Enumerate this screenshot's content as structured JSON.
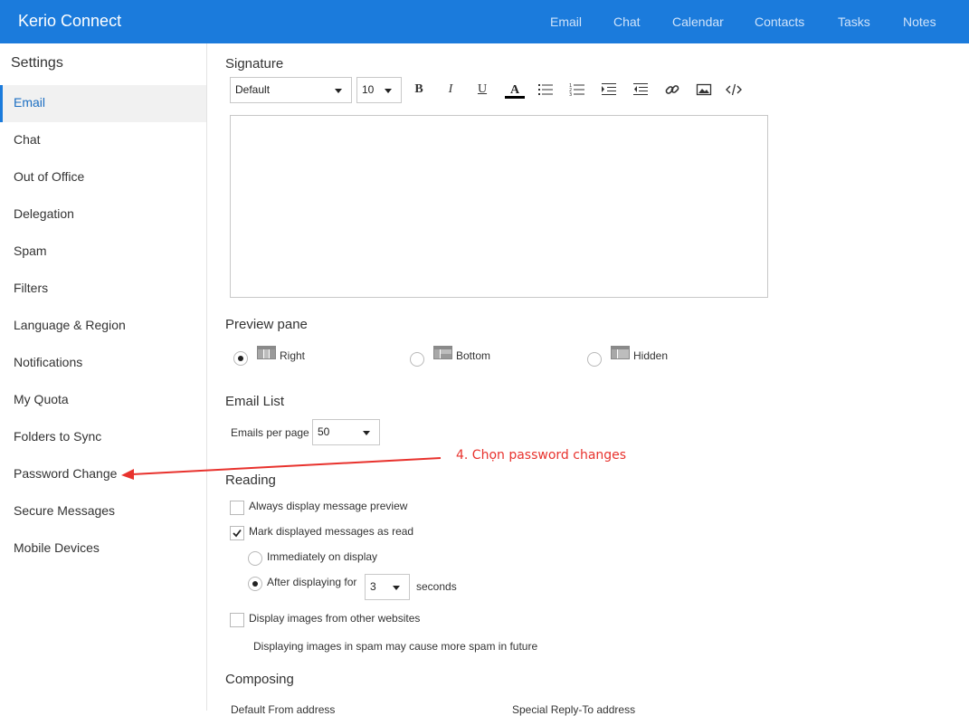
{
  "app": {
    "title": "Kerio Connect"
  },
  "nav": [
    "Email",
    "Chat",
    "Calendar",
    "Contacts",
    "Tasks",
    "Notes"
  ],
  "sidebar": {
    "title": "Settings",
    "items": [
      "Email",
      "Chat",
      "Out of Office",
      "Delegation",
      "Spam",
      "Filters",
      "Language & Region",
      "Notifications",
      "My Quota",
      "Folders to Sync",
      "Password Change",
      "Secure Messages",
      "Mobile Devices"
    ],
    "active": "Email"
  },
  "signature": {
    "title": "Signature",
    "font": "Default",
    "size": "10",
    "toolbar_icons": [
      "bold-icon",
      "italic-icon",
      "underline-icon",
      "font-color-icon",
      "bulleted-list-icon",
      "numbered-list-icon",
      "indent-icon",
      "outdent-icon",
      "link-icon",
      "image-icon",
      "source-code-icon"
    ],
    "font_color": "#000000"
  },
  "preview": {
    "title": "Preview pane",
    "options": [
      "Right",
      "Bottom",
      "Hidden"
    ],
    "selected": "Right"
  },
  "email_list": {
    "title": "Email List",
    "per_page_label": "Emails per page",
    "per_page_value": "50"
  },
  "reading": {
    "title": "Reading",
    "always_preview_label": "Always display message preview",
    "always_preview_checked": false,
    "mark_read_label": "Mark displayed messages as read",
    "mark_read_checked": true,
    "immediately_label": "Immediately on display",
    "after_label": "After displaying for",
    "after_value": "3",
    "seconds_label": "seconds",
    "after_selected": true,
    "images_label": "Display images from other websites",
    "images_checked": false,
    "spam_note": "Displaying images in spam may cause more spam in future"
  },
  "composing": {
    "title": "Composing",
    "default_from_label": "Default From address",
    "reply_to_label": "Special Reply-To address"
  },
  "annotation": {
    "text": "4. Chọn password changes",
    "color": "#e8322d"
  },
  "colors": {
    "brand": "#1b7bdc",
    "active_text": "#1b6ec2"
  }
}
